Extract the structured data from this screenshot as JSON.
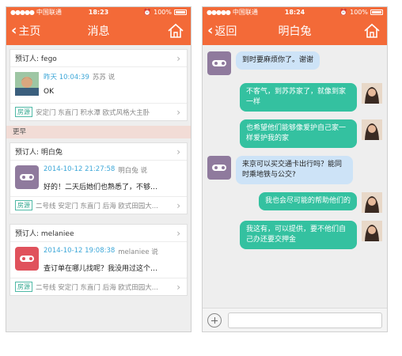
{
  "status_left": {
    "carrier": "中国联通",
    "time": "18:23",
    "battery": "100%"
  },
  "status_right": {
    "carrier": "中国联通",
    "time": "18:24",
    "battery": "100%"
  },
  "left_nav": {
    "back_label": "主页",
    "title": "消息"
  },
  "right_nav": {
    "back_label": "返回",
    "title": "明白兔"
  },
  "orders": [
    {
      "orderer_label": "预订人: fego",
      "time": "昨天 10:04:39",
      "sender": "苏苏 说",
      "message": "OK",
      "tag": "房源",
      "address": "安定门 东直门 积水潭 欧式风格大主卧",
      "avatar": "photo"
    }
  ],
  "section_label": "更早",
  "earlier_orders": [
    {
      "orderer_label": "预订人: 明白兔",
      "time": "2014-10-12 21:27:58",
      "sender": "明白兔 说",
      "message": "好的！二天后她们也熟悉了，不够她们自...",
      "tag": "房源",
      "address": "二号线 安定门 东直门 后海 欧式田园大...",
      "avatar_color": "#8f7a9d"
    },
    {
      "orderer_label": "预订人: melaniee",
      "time": "2014-10-12 19:08:38",
      "sender": "melaniee 说",
      "message": "查订单在哪儿找呢？我没用过这个小猪",
      "tag": "房源",
      "address": "二号线 安定门 东直门 后海 欧式田园大...",
      "avatar_color": "#e0525c"
    }
  ],
  "chat": [
    {
      "dir": "in",
      "text": "到时要麻烦你了。谢谢"
    },
    {
      "dir": "out",
      "text": "不客气，到苏苏家了，就像到家一样"
    },
    {
      "dir": "out",
      "text": "也希望他们能够像爱护自己家一样爱护我的家"
    },
    {
      "dir": "in",
      "text": "来京可以买交通卡出行吗？能同时乘地铁与公交?"
    },
    {
      "dir": "out",
      "text": "我也会尽可能的帮助他们的"
    },
    {
      "dir": "out",
      "text": "我这有，可以提供，要不他们自己办还要交押金"
    }
  ],
  "colors": {
    "brand": "#f36a38",
    "bubble_in": "#cde3f7",
    "bubble_out": "#34c1a0",
    "bot_avatar": "#8f7a9d"
  },
  "icons": [
    "back-chevron-icon",
    "home-icon",
    "add-icon",
    "wifi-icon",
    "alarm-icon",
    "battery-icon"
  ]
}
